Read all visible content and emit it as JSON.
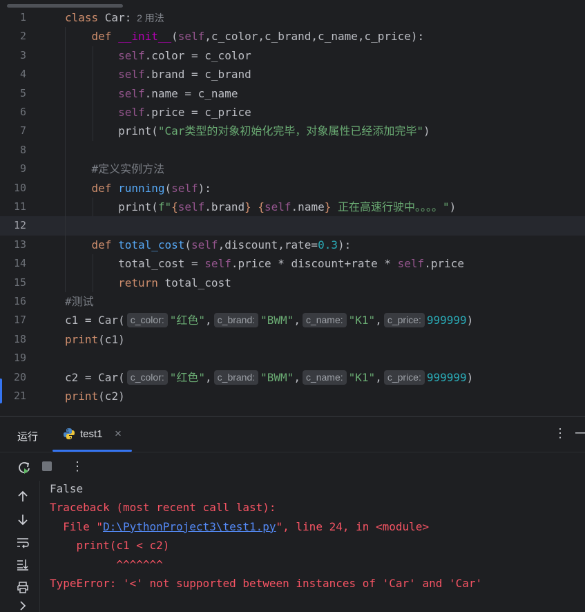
{
  "editor": {
    "lines": [
      {
        "n": "1",
        "parts": [
          {
            "t": "class ",
            "c": "kw"
          },
          {
            "t": "Car:",
            "c": ""
          },
          {
            "t": "  2 用法",
            "c": "hint-inline"
          }
        ]
      },
      {
        "n": "2",
        "parts": [
          {
            "t": "    def ",
            "c": "kw"
          },
          {
            "t": "__init__",
            "c": "dunder"
          },
          {
            "t": "(",
            "c": ""
          },
          {
            "t": "self",
            "c": "self"
          },
          {
            "t": ",c_color,c_brand,c_name,c_price):",
            "c": ""
          }
        ]
      },
      {
        "n": "3",
        "parts": [
          {
            "t": "        ",
            "c": ""
          },
          {
            "t": "self",
            "c": "self"
          },
          {
            "t": ".color = c_color",
            "c": ""
          }
        ]
      },
      {
        "n": "4",
        "parts": [
          {
            "t": "        ",
            "c": ""
          },
          {
            "t": "self",
            "c": "self"
          },
          {
            "t": ".brand = c_brand",
            "c": ""
          }
        ]
      },
      {
        "n": "5",
        "parts": [
          {
            "t": "        ",
            "c": ""
          },
          {
            "t": "self",
            "c": "self"
          },
          {
            "t": ".name = c_name",
            "c": ""
          }
        ]
      },
      {
        "n": "6",
        "parts": [
          {
            "t": "        ",
            "c": ""
          },
          {
            "t": "self",
            "c": "self"
          },
          {
            "t": ".price = c_price",
            "c": ""
          }
        ]
      },
      {
        "n": "7",
        "parts": [
          {
            "t": "        print",
            "c": ""
          },
          {
            "t": "(",
            "c": ""
          },
          {
            "t": "\"Car类型的对象初始化完毕，对象属性已经添加完毕\"",
            "c": "str"
          },
          {
            "t": ")",
            "c": ""
          }
        ]
      },
      {
        "n": "8",
        "parts": []
      },
      {
        "n": "9",
        "parts": [
          {
            "t": "    #定义实例方法",
            "c": "cmt"
          }
        ]
      },
      {
        "n": "10",
        "parts": [
          {
            "t": "    def ",
            "c": "kw"
          },
          {
            "t": "running",
            "c": "fn"
          },
          {
            "t": "(",
            "c": ""
          },
          {
            "t": "self",
            "c": "self"
          },
          {
            "t": "):",
            "c": ""
          }
        ]
      },
      {
        "n": "11",
        "parts": [
          {
            "t": "        print(",
            "c": ""
          },
          {
            "t": "f\"",
            "c": "str"
          },
          {
            "t": "{",
            "c": "kw"
          },
          {
            "t": "self",
            "c": "self"
          },
          {
            "t": ".brand",
            "c": ""
          },
          {
            "t": "}",
            "c": "kw"
          },
          {
            "t": " ",
            "c": "str"
          },
          {
            "t": "{",
            "c": "kw"
          },
          {
            "t": "self",
            "c": "self"
          },
          {
            "t": ".name",
            "c": ""
          },
          {
            "t": "}",
            "c": "kw"
          },
          {
            "t": " 正在高速行驶中。。。。\"",
            "c": "str"
          },
          {
            "t": ")",
            "c": ""
          }
        ]
      },
      {
        "n": "12",
        "parts": [],
        "current": true
      },
      {
        "n": "13",
        "parts": [
          {
            "t": "    def ",
            "c": "kw"
          },
          {
            "t": "total_cost",
            "c": "fn"
          },
          {
            "t": "(",
            "c": ""
          },
          {
            "t": "self",
            "c": "self"
          },
          {
            "t": ",discount,rate=",
            "c": ""
          },
          {
            "t": "0.3",
            "c": "num"
          },
          {
            "t": "):",
            "c": ""
          }
        ]
      },
      {
        "n": "14",
        "parts": [
          {
            "t": "        total_cost = ",
            "c": ""
          },
          {
            "t": "self",
            "c": "self"
          },
          {
            "t": ".price * discount+rate * ",
            "c": ""
          },
          {
            "t": "self",
            "c": "self"
          },
          {
            "t": ".price",
            "c": ""
          }
        ]
      },
      {
        "n": "15",
        "parts": [
          {
            "t": "        return ",
            "c": "kw"
          },
          {
            "t": "total_cost",
            "c": ""
          }
        ]
      },
      {
        "n": "16",
        "parts": [
          {
            "t": "#测试",
            "c": "cmt"
          }
        ]
      },
      {
        "n": "17",
        "parts": [
          {
            "t": "c1 = Car(",
            "c": ""
          },
          {
            "t": "c_color:",
            "c": "ph"
          },
          {
            "t": "\"红色\"",
            "c": "str"
          },
          {
            "t": ",",
            "c": ""
          },
          {
            "t": "c_brand:",
            "c": "ph"
          },
          {
            "t": "\"BWM\"",
            "c": "str"
          },
          {
            "t": ",",
            "c": ""
          },
          {
            "t": "c_name:",
            "c": "ph"
          },
          {
            "t": "\"K1\"",
            "c": "str"
          },
          {
            "t": ",",
            "c": ""
          },
          {
            "t": "c_price:",
            "c": "ph"
          },
          {
            "t": "999999",
            "c": "num"
          },
          {
            "t": ")",
            "c": ""
          }
        ]
      },
      {
        "n": "18",
        "parts": [
          {
            "t": "print",
            "c": "kw"
          },
          {
            "t": "(c1)",
            "c": ""
          }
        ]
      },
      {
        "n": "19",
        "parts": []
      },
      {
        "n": "20",
        "parts": [
          {
            "t": "c2 = Car(",
            "c": ""
          },
          {
            "t": "c_color:",
            "c": "ph"
          },
          {
            "t": "\"红色\"",
            "c": "str"
          },
          {
            "t": ",",
            "c": ""
          },
          {
            "t": "c_brand:",
            "c": "ph"
          },
          {
            "t": "\"BWM\"",
            "c": "str"
          },
          {
            "t": ",",
            "c": ""
          },
          {
            "t": "c_name:",
            "c": "ph"
          },
          {
            "t": "\"K1\"",
            "c": "str"
          },
          {
            "t": ",",
            "c": ""
          },
          {
            "t": "c_price:",
            "c": "ph"
          },
          {
            "t": "999999",
            "c": "num"
          },
          {
            "t": ")",
            "c": ""
          }
        ]
      },
      {
        "n": "21",
        "parts": [
          {
            "t": "print",
            "c": "kw"
          },
          {
            "t": "(c2)",
            "c": ""
          }
        ]
      }
    ]
  },
  "run_panel": {
    "title": "运行",
    "tab_label": "test1",
    "tab_close": "×",
    "more": "⋮",
    "minimize": "—"
  },
  "toolbar": {
    "more": "⋮"
  },
  "console": {
    "lines": [
      {
        "parts": [
          {
            "t": "False",
            "c": "out"
          }
        ]
      },
      {
        "parts": [
          {
            "t": "Traceback (most recent call last):",
            "c": "err"
          }
        ]
      },
      {
        "parts": [
          {
            "t": "  File \"",
            "c": "err"
          },
          {
            "t": "D:\\PythonProject3\\test1.py",
            "c": "link"
          },
          {
            "t": "\", line 24, in <module>",
            "c": "err"
          }
        ]
      },
      {
        "parts": [
          {
            "t": "    print(c1 < c2)",
            "c": "err"
          }
        ]
      },
      {
        "parts": [
          {
            "t": "          ^^^^^^^",
            "c": "err"
          }
        ]
      },
      {
        "parts": [
          {
            "t": "TypeError: '<' not supported between instances of 'Car' and 'Car'",
            "c": "err"
          }
        ]
      }
    ]
  },
  "colors": {
    "accent": "#3574f0",
    "keyword": "#cf8e6d",
    "function": "#56a8f5",
    "string": "#6aab73",
    "number": "#2aacb8",
    "self": "#94558d",
    "error": "#f75464"
  }
}
